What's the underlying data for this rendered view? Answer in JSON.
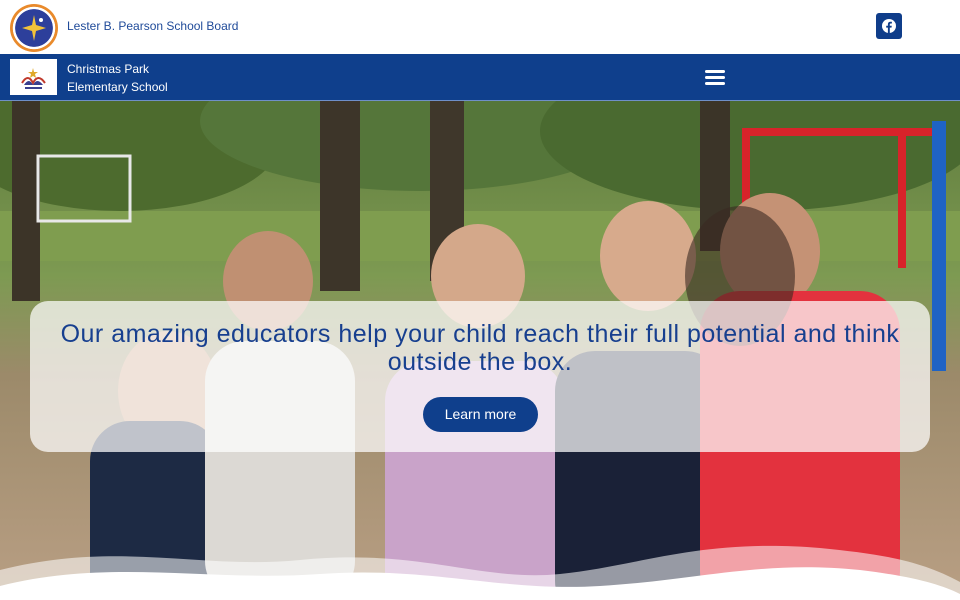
{
  "header": {
    "board_name": "Lester B. Pearson School Board",
    "logo_icon": "board-logo-icon",
    "social_icon": "facebook-icon"
  },
  "nav": {
    "school_name_line1": "Christmas Park",
    "school_name_line2": "Elementary School",
    "menu_icon": "hamburger-menu-icon"
  },
  "hero": {
    "headline": "Our amazing educators help your child reach their full potential and think outside the box.",
    "cta_label": "Learn more",
    "background_image": "children-playground-photo"
  },
  "colors": {
    "brand_blue": "#0f3f8c",
    "headline_blue": "#173f8f",
    "white": "#ffffff"
  }
}
